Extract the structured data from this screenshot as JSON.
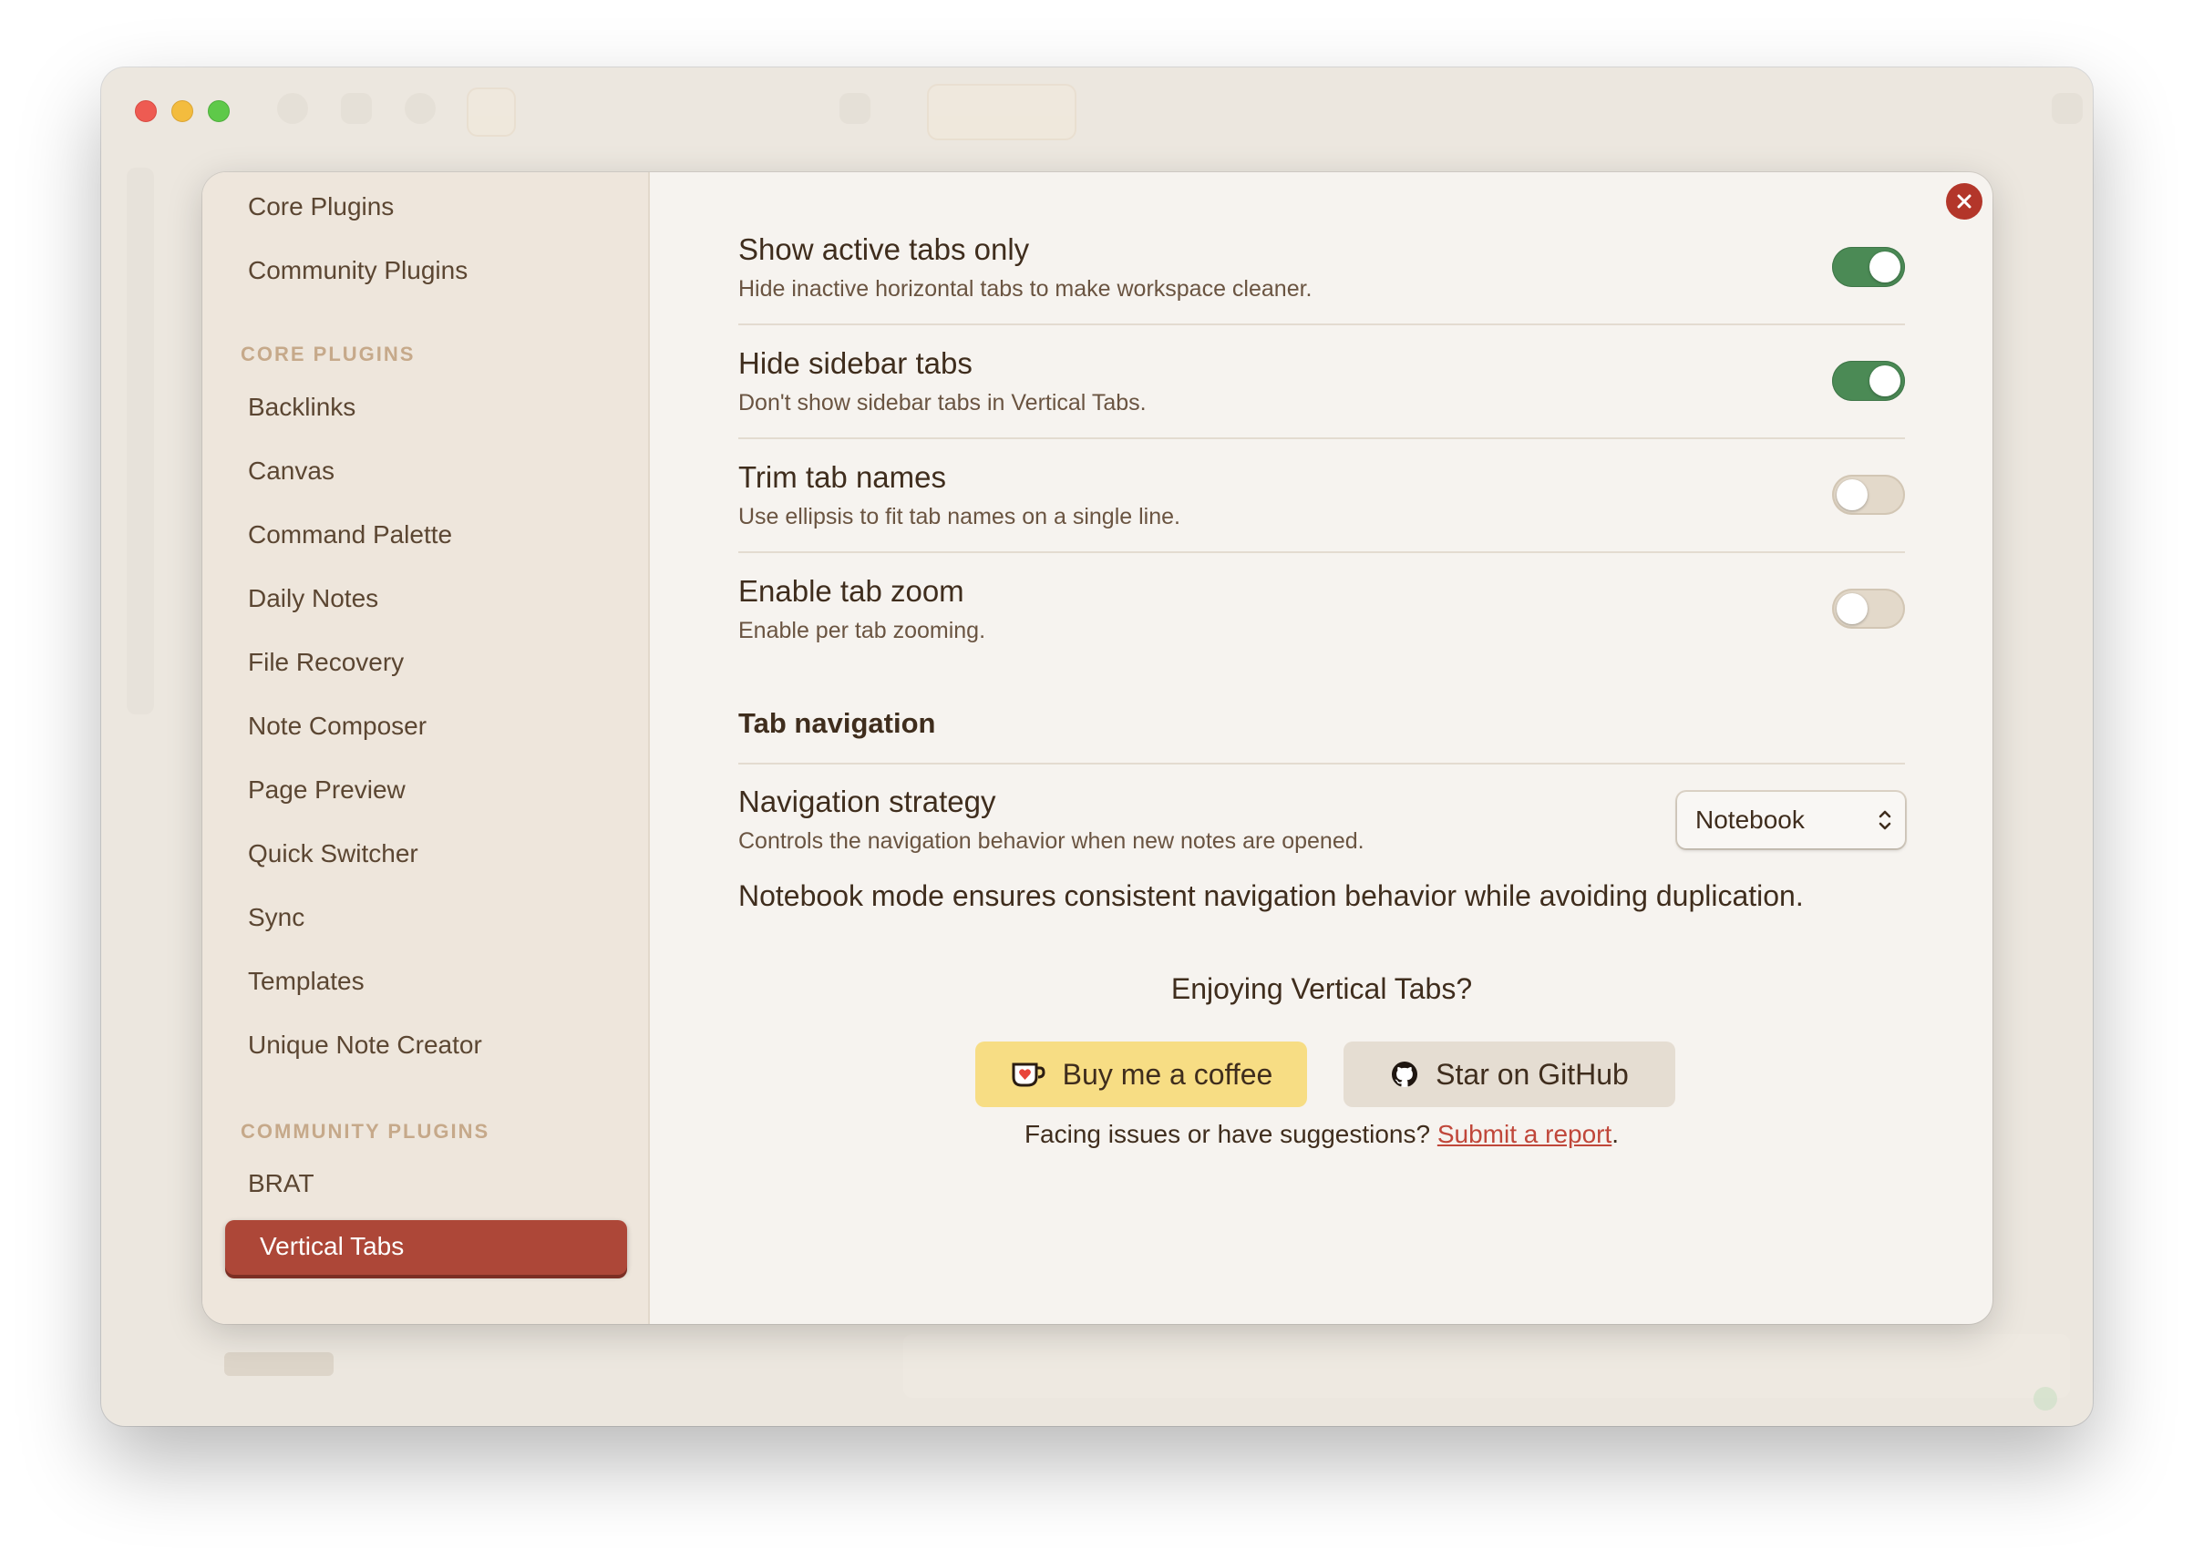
{
  "sidebar": {
    "top_items": [
      {
        "label": "Core Plugins"
      },
      {
        "label": "Community Plugins"
      }
    ],
    "core_heading": "CORE PLUGINS",
    "core_items": [
      {
        "label": "Backlinks"
      },
      {
        "label": "Canvas"
      },
      {
        "label": "Command Palette"
      },
      {
        "label": "Daily Notes"
      },
      {
        "label": "File Recovery"
      },
      {
        "label": "Note Composer"
      },
      {
        "label": "Page Preview"
      },
      {
        "label": "Quick Switcher"
      },
      {
        "label": "Sync"
      },
      {
        "label": "Templates"
      },
      {
        "label": "Unique Note Creator"
      }
    ],
    "community_heading": "COMMUNITY PLUGINS",
    "community_items": [
      {
        "label": "BRAT"
      },
      {
        "label": "Vertical Tabs",
        "active": true
      }
    ]
  },
  "settings": [
    {
      "title": "Show active tabs only",
      "desc": "Hide inactive horizontal tabs to make workspace cleaner.",
      "enabled": true
    },
    {
      "title": "Hide sidebar tabs",
      "desc": "Don't show sidebar tabs in Vertical Tabs.",
      "enabled": true
    },
    {
      "title": "Trim tab names",
      "desc": "Use ellipsis to fit tab names on a single line.",
      "enabled": false
    },
    {
      "title": "Enable tab zoom",
      "desc": "Enable per tab zooming.",
      "enabled": false
    }
  ],
  "tab_navigation": {
    "heading": "Tab navigation",
    "strategy_title": "Navigation strategy",
    "strategy_desc": "Controls the navigation behavior when new notes are opened.",
    "strategy_value": "Notebook",
    "strategy_note": "Notebook mode ensures consistent navigation behavior while avoiding duplication."
  },
  "promo": {
    "enjoy": "Enjoying Vertical Tabs?",
    "coffee_label": "Buy me a coffee",
    "github_label": "Star on GitHub",
    "feedback_prefix": "Facing issues or have suggestions? ",
    "feedback_link": "Submit a report",
    "feedback_suffix": "."
  },
  "colors": {
    "accent": "#ad4738",
    "toggle_on": "#4b8a55",
    "coffee": "#f7dd84",
    "link": "#c0473a"
  },
  "icons": {
    "close": "close-icon",
    "coffee": "ko-fi-cup-icon",
    "github": "github-icon",
    "select": "chevron-up-down-icon"
  }
}
